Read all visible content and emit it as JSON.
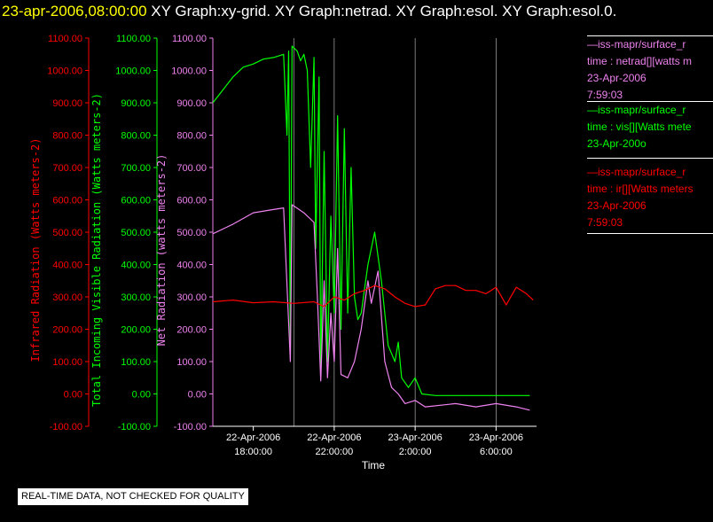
{
  "title": {
    "date": "23-apr-2006,08:00:00",
    "rest": " XY Graph:xy-grid.  XY Graph:netrad.  XY Graph:esol.  XY Graph:esol.0."
  },
  "notice": "REAL-TIME DATA, NOT CHECKED FOR QUALITY",
  "colors": {
    "ir": "#ff0000",
    "vis": "#00ff00",
    "net": "#ee82ee",
    "grid": "#ffffff",
    "bg": "#000000"
  },
  "legend": [
    {
      "line1": "—iss-mapr/surface_r",
      "line2": "time : netrad[][watts m",
      "line3": "23-Apr-2006",
      "line4": "7:59:03",
      "color": "#ee82ee"
    },
    {
      "line1": "—iss-mapr/surface_r",
      "line2": "time : vis[][Watts mete",
      "line3": "23-Apr-200o",
      "line4": "",
      "color": "#00ff00"
    },
    {
      "line1": "—iss-mapr/surface_r",
      "line2": "time : ir[][Watts meters",
      "line3": "23-Apr-2006",
      "line4": "7:59:03",
      "color": "#ff0000"
    }
  ],
  "chart_data": {
    "type": "line",
    "xlabel": "Time",
    "x_ticks": [
      {
        "t": "2006-04-22 18:00",
        "line1": "22-Apr-2006",
        "line2": "18:00:00"
      },
      {
        "t": "2006-04-22 22:00",
        "line1": "22-Apr-2006",
        "line2": "22:00:00"
      },
      {
        "t": "2006-04-23 02:00",
        "line1": "23-Apr-2006",
        "line2": "2:00:00"
      },
      {
        "t": "2006-04-23 06:00",
        "line1": "23-Apr-2006",
        "line2": "6:00:00"
      }
    ],
    "xlim": [
      "2006-04-22 16:00",
      "2006-04-23 08:00"
    ],
    "vgrid_at": [
      "2006-04-22 20:00",
      "2006-04-22 22:00",
      "2006-04-23 02:00",
      "2006-04-23 06:00"
    ],
    "axes": [
      {
        "id": "ir",
        "label": "Infrared Radiation (Watts meters-2)",
        "color": "#ff0000",
        "ylim": [
          -100,
          1100
        ],
        "ticks": [
          "-100.00",
          "0.00",
          "100.00",
          "200.00",
          "300.00",
          "400.00",
          "500.00",
          "600.00",
          "700.00",
          "800.00",
          "900.00",
          "1000.00",
          "1100.00"
        ]
      },
      {
        "id": "vis",
        "label": "Total Incoming Visible Radiation (Watts meters-2)",
        "color": "#00ff00",
        "ylim": [
          -100,
          1100
        ],
        "ticks": [
          "-100.00",
          "0.00",
          "100.00",
          "200.00",
          "300.00",
          "400.00",
          "500.00",
          "600.00",
          "700.00",
          "800.00",
          "900.00",
          "1000.00",
          "1100.00"
        ]
      },
      {
        "id": "net",
        "label": "Net Radiation (watts meters-2)",
        "color": "#ee82ee",
        "ylim": [
          -100,
          1100
        ],
        "ticks": [
          "-100.00",
          "0.00",
          "100.00",
          "200.00",
          "300.00",
          "400.00",
          "500.00",
          "600.00",
          "700.00",
          "800.00",
          "900.00",
          "1000.00",
          "1100.00"
        ]
      }
    ],
    "series": [
      {
        "name": "vis",
        "color": "#00ff00",
        "points": [
          [
            "2006-04-22 16:00",
            900
          ],
          [
            "2006-04-22 16:30",
            940
          ],
          [
            "2006-04-22 17:00",
            980
          ],
          [
            "2006-04-22 17:30",
            1010
          ],
          [
            "2006-04-22 18:00",
            1020
          ],
          [
            "2006-04-22 18:30",
            1035
          ],
          [
            "2006-04-22 19:00",
            1040
          ],
          [
            "2006-04-22 19:30",
            1050
          ],
          [
            "2006-04-22 19:40",
            800
          ],
          [
            "2006-04-22 19:45",
            1060
          ],
          [
            "2006-04-22 19:50",
            110
          ],
          [
            "2006-04-22 19:55",
            1075
          ],
          [
            "2006-04-22 20:10",
            1060
          ],
          [
            "2006-04-22 20:20",
            1030
          ],
          [
            "2006-04-22 20:30",
            1050
          ],
          [
            "2006-04-22 20:40",
            1000
          ],
          [
            "2006-04-22 20:50",
            700
          ],
          [
            "2006-04-22 21:00",
            1040
          ],
          [
            "2006-04-22 21:05",
            450
          ],
          [
            "2006-04-22 21:15",
            980
          ],
          [
            "2006-04-22 21:20",
            60
          ],
          [
            "2006-04-22 21:30",
            750
          ],
          [
            "2006-04-22 21:40",
            100
          ],
          [
            "2006-04-22 21:50",
            550
          ],
          [
            "2006-04-22 22:00",
            250
          ],
          [
            "2006-04-22 22:10",
            860
          ],
          [
            "2006-04-22 22:20",
            200
          ],
          [
            "2006-04-22 22:30",
            820
          ],
          [
            "2006-04-22 22:40",
            250
          ],
          [
            "2006-04-22 22:50",
            700
          ],
          [
            "2006-04-22 23:00",
            300
          ],
          [
            "2006-04-22 23:10",
            230
          ],
          [
            "2006-04-22 23:20",
            250
          ],
          [
            "2006-04-22 23:40",
            400
          ],
          [
            "2006-04-23 00:00",
            500
          ],
          [
            "2006-04-23 00:20",
            350
          ],
          [
            "2006-04-23 00:40",
            150
          ],
          [
            "2006-04-23 01:00",
            100
          ],
          [
            "2006-04-23 01:10",
            160
          ],
          [
            "2006-04-23 01:20",
            50
          ],
          [
            "2006-04-23 01:40",
            20
          ],
          [
            "2006-04-23 02:00",
            50
          ],
          [
            "2006-04-23 02:20",
            0
          ],
          [
            "2006-04-23 03:00",
            -5
          ],
          [
            "2006-04-23 05:00",
            -5
          ],
          [
            "2006-04-23 07:00",
            -5
          ],
          [
            "2006-04-23 07:40",
            -5
          ]
        ]
      },
      {
        "name": "net",
        "color": "#ee82ee",
        "points": [
          [
            "2006-04-22 16:00",
            495
          ],
          [
            "2006-04-22 17:00",
            525
          ],
          [
            "2006-04-22 18:00",
            560
          ],
          [
            "2006-04-22 19:00",
            570
          ],
          [
            "2006-04-22 19:30",
            575
          ],
          [
            "2006-04-22 19:50",
            100
          ],
          [
            "2006-04-22 19:55",
            585
          ],
          [
            "2006-04-22 20:30",
            560
          ],
          [
            "2006-04-22 21:00",
            530
          ],
          [
            "2006-04-22 21:10",
            300
          ],
          [
            "2006-04-22 21:20",
            40
          ],
          [
            "2006-04-22 21:30",
            350
          ],
          [
            "2006-04-22 21:40",
            50
          ],
          [
            "2006-04-22 21:50",
            250
          ],
          [
            "2006-04-22 22:00",
            100
          ],
          [
            "2006-04-22 22:10",
            450
          ],
          [
            "2006-04-22 22:20",
            60
          ],
          [
            "2006-04-22 22:40",
            50
          ],
          [
            "2006-04-22 23:00",
            100
          ],
          [
            "2006-04-22 23:20",
            200
          ],
          [
            "2006-04-22 23:40",
            350
          ],
          [
            "2006-04-22 23:50",
            280
          ],
          [
            "2006-04-23 00:10",
            380
          ],
          [
            "2006-04-23 00:30",
            100
          ],
          [
            "2006-04-23 00:50",
            20
          ],
          [
            "2006-04-23 01:10",
            0
          ],
          [
            "2006-04-23 01:30",
            -30
          ],
          [
            "2006-04-23 02:00",
            -20
          ],
          [
            "2006-04-23 02:30",
            -40
          ],
          [
            "2006-04-23 04:00",
            -30
          ],
          [
            "2006-04-23 05:00",
            -40
          ],
          [
            "2006-04-23 06:00",
            -30
          ],
          [
            "2006-04-23 07:00",
            -40
          ],
          [
            "2006-04-23 07:40",
            -50
          ]
        ]
      },
      {
        "name": "ir",
        "color": "#ff0000",
        "points": [
          [
            "2006-04-22 16:00",
            285
          ],
          [
            "2006-04-22 17:00",
            290
          ],
          [
            "2006-04-22 18:00",
            282
          ],
          [
            "2006-04-22 19:00",
            285
          ],
          [
            "2006-04-22 20:00",
            280
          ],
          [
            "2006-04-22 21:00",
            285
          ],
          [
            "2006-04-22 21:30",
            270
          ],
          [
            "2006-04-22 22:00",
            300
          ],
          [
            "2006-04-22 22:30",
            290
          ],
          [
            "2006-04-22 23:00",
            310
          ],
          [
            "2006-04-22 23:30",
            320
          ],
          [
            "2006-04-23 00:00",
            335
          ],
          [
            "2006-04-23 00:30",
            325
          ],
          [
            "2006-04-23 01:00",
            300
          ],
          [
            "2006-04-23 01:30",
            280
          ],
          [
            "2006-04-23 02:00",
            270
          ],
          [
            "2006-04-23 02:30",
            275
          ],
          [
            "2006-04-23 03:00",
            325
          ],
          [
            "2006-04-23 03:30",
            335
          ],
          [
            "2006-04-23 04:00",
            335
          ],
          [
            "2006-04-23 04:30",
            320
          ],
          [
            "2006-04-23 05:00",
            320
          ],
          [
            "2006-04-23 05:30",
            310
          ],
          [
            "2006-04-23 06:00",
            330
          ],
          [
            "2006-04-23 06:30",
            275
          ],
          [
            "2006-04-23 07:00",
            330
          ],
          [
            "2006-04-23 07:30",
            310
          ],
          [
            "2006-04-23 07:50",
            290
          ]
        ]
      }
    ],
    "grid": true,
    "legend_position": "right"
  }
}
